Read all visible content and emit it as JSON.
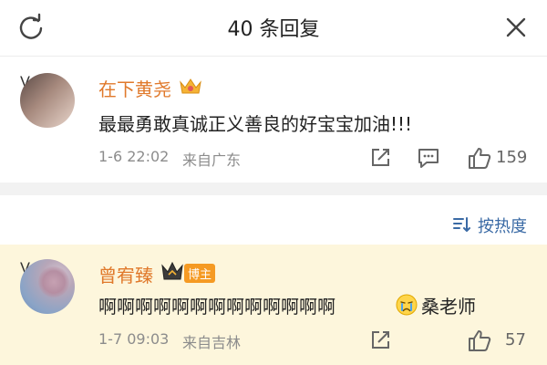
{
  "header": {
    "title": "40 条回复"
  },
  "comments": [
    {
      "username": "在下黄尧",
      "text": "最最勇敢真诚正义善良的好宝宝加油!!!",
      "time": "1-6 22:02",
      "source": "来自广东",
      "likes": "159"
    },
    {
      "username": "曾宥臻",
      "tag": "博主",
      "text": "啊啊啊啊啊啊啊啊啊啊啊啊啊",
      "text_suffix": "桑老师",
      "time": "1-7 09:03",
      "source": "来自吉林",
      "likes": "57"
    }
  ],
  "sort": {
    "label": "按热度"
  },
  "colors": {
    "username": "#e0792b",
    "link": "#3a6aa5",
    "badge": "#f5a623",
    "highlight_bg": "#fdf6dc"
  }
}
